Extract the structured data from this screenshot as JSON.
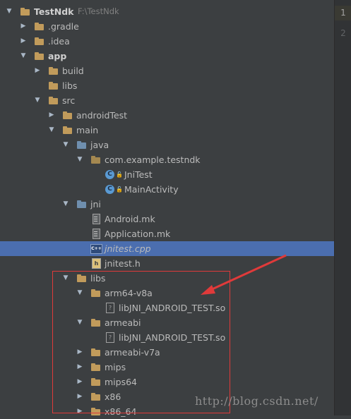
{
  "project": {
    "name": "TestNdk",
    "path": "F:\\TestNdk"
  },
  "tree": [
    {
      "label": "TestNdk",
      "path": "F:\\TestNdk",
      "depth": 0,
      "expanded": true,
      "icon": "module-folder-icon",
      "bold": true
    },
    {
      "label": ".gradle",
      "depth": 1,
      "expanded": false,
      "icon": "folder-icon"
    },
    {
      "label": ".idea",
      "depth": 1,
      "expanded": false,
      "icon": "folder-icon"
    },
    {
      "label": "app",
      "depth": 1,
      "expanded": true,
      "icon": "module-folder-icon",
      "bold": true
    },
    {
      "label": "build",
      "depth": 2,
      "expanded": false,
      "icon": "folder-icon"
    },
    {
      "label": "libs",
      "depth": 2,
      "expanded": null,
      "icon": "folder-icon"
    },
    {
      "label": "src",
      "depth": 2,
      "expanded": true,
      "icon": "folder-icon"
    },
    {
      "label": "androidTest",
      "depth": 3,
      "expanded": false,
      "icon": "folder-icon"
    },
    {
      "label": "main",
      "depth": 3,
      "expanded": true,
      "icon": "folder-icon"
    },
    {
      "label": "java",
      "depth": 4,
      "expanded": true,
      "icon": "source-folder-icon"
    },
    {
      "label": "com.example.testndk",
      "depth": 5,
      "expanded": true,
      "icon": "package-icon"
    },
    {
      "label": "JniTest",
      "depth": 6,
      "expanded": null,
      "icon": "java-class-icon"
    },
    {
      "label": "MainActivity",
      "depth": 6,
      "expanded": null,
      "icon": "java-class-icon"
    },
    {
      "label": "jni",
      "depth": 4,
      "expanded": true,
      "icon": "source-folder-icon"
    },
    {
      "label": "Android.mk",
      "depth": 5,
      "expanded": null,
      "icon": "text-file-icon"
    },
    {
      "label": "Application.mk",
      "depth": 5,
      "expanded": null,
      "icon": "text-file-icon"
    },
    {
      "label": "jnitest.cpp",
      "depth": 5,
      "expanded": null,
      "icon": "cpp-file-icon",
      "selected": true,
      "italic": true
    },
    {
      "label": "jnitest.h",
      "depth": 5,
      "expanded": null,
      "icon": "header-file-icon"
    },
    {
      "label": "libs",
      "depth": 4,
      "expanded": true,
      "icon": "folder-icon"
    },
    {
      "label": "arm64-v8a",
      "depth": 5,
      "expanded": true,
      "icon": "folder-icon"
    },
    {
      "label": "libJNI_ANDROID_TEST.so",
      "depth": 6,
      "expanded": null,
      "icon": "unknown-file-icon"
    },
    {
      "label": "armeabi",
      "depth": 5,
      "expanded": true,
      "icon": "folder-icon"
    },
    {
      "label": "libJNI_ANDROID_TEST.so",
      "depth": 6,
      "expanded": null,
      "icon": "unknown-file-icon"
    },
    {
      "label": "armeabi-v7a",
      "depth": 5,
      "expanded": false,
      "icon": "folder-icon"
    },
    {
      "label": "mips",
      "depth": 5,
      "expanded": false,
      "icon": "folder-icon"
    },
    {
      "label": "mips64",
      "depth": 5,
      "expanded": false,
      "icon": "folder-icon"
    },
    {
      "label": "x86",
      "depth": 5,
      "expanded": false,
      "icon": "folder-icon"
    },
    {
      "label": "x86_64",
      "depth": 5,
      "expanded": false,
      "icon": "folder-icon"
    }
  ],
  "gutter": {
    "lines": [
      "1",
      "2"
    ],
    "current_line": "1"
  },
  "watermark": "http://blog.csdn.net/",
  "colors": {
    "selection": "#4b6eaf",
    "annotation": "#e03a3a",
    "background": "#3c3f41"
  }
}
